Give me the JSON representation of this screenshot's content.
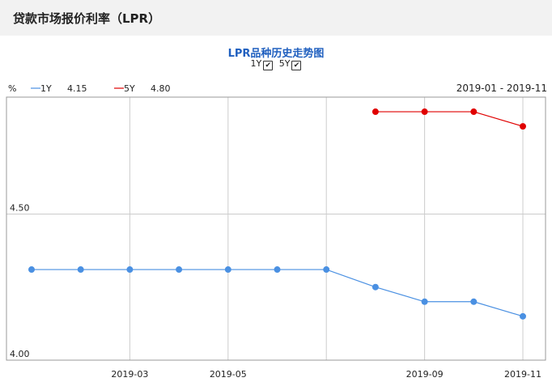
{
  "header": {
    "title": "贷款市场报价利率（LPR）"
  },
  "chart_data": {
    "type": "line",
    "title": "LPR品种历史走势图",
    "toggles": [
      {
        "label": "1Y",
        "checked": true
      },
      {
        "label": "5Y",
        "checked": true
      }
    ],
    "ylabel": "%",
    "range_label": "2019-01 - 2019-11",
    "x": [
      "2019-01",
      "2019-02",
      "2019-03",
      "2019-04",
      "2019-05",
      "2019-06",
      "2019-07",
      "2019-08",
      "2019-09",
      "2019-10",
      "2019-11"
    ],
    "xticks": [
      "2019-03",
      "2019-05",
      "2019-09",
      "2019-11"
    ],
    "ylim": [
      4.0,
      4.9
    ],
    "yticks": [
      "4.50",
      "4.00"
    ],
    "grid": true,
    "series": [
      {
        "name": "1Y",
        "legend_value": "4.15",
        "color": "#4a90e2",
        "values": [
          4.31,
          4.31,
          4.31,
          4.31,
          4.31,
          4.31,
          4.31,
          4.25,
          4.2,
          4.2,
          4.15
        ]
      },
      {
        "name": "5Y",
        "legend_value": "4.80",
        "color": "#e00000",
        "values": [
          null,
          null,
          null,
          null,
          null,
          null,
          null,
          4.85,
          4.85,
          4.85,
          4.8
        ]
      }
    ]
  }
}
